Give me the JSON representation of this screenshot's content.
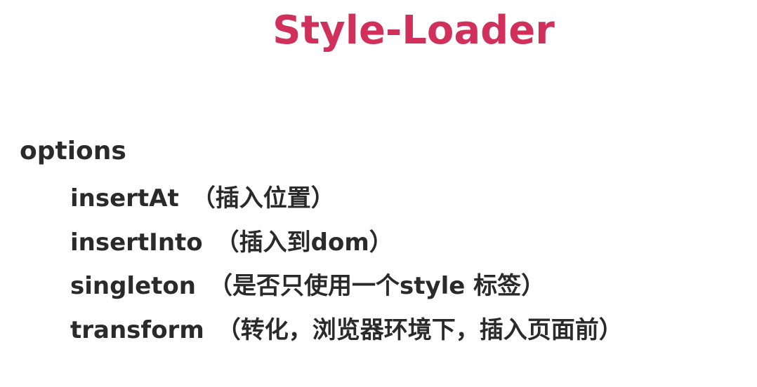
{
  "slide": {
    "title": "Style-Loader",
    "section_label": "options",
    "items": [
      {
        "key": "insertAt",
        "desc": "（插入位置）"
      },
      {
        "key": "insertInto",
        "desc": "（插入到dom）"
      },
      {
        "key": "singleton",
        "desc": "（是否只使用一个style 标签）"
      },
      {
        "key": "transform",
        "desc": "（转化，浏览器环境下，插入页面前）"
      }
    ]
  },
  "colors": {
    "title": "#d0305a",
    "text": "#2a2a2a",
    "background": "#ffffff"
  }
}
